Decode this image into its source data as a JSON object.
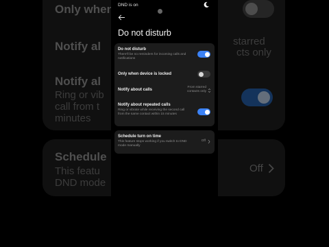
{
  "status": {
    "text": "DND is on"
  },
  "page": {
    "title": "Do not disturb"
  },
  "settings": {
    "dnd": {
      "title": "Do not disturb",
      "subtitle": "There'll be no reminders for incoming calls and notifications",
      "enabled": true
    },
    "locked": {
      "title": "Only when device is locked",
      "enabled": false
    },
    "calls": {
      "title": "Notify about calls",
      "value_line1": "From starred",
      "value_line2": "contacts only"
    },
    "repeated": {
      "title": "Notify about repeated calls",
      "subtitle": "Ring or vibrate while receiving the second call from the same contact within 15 minutes",
      "enabled": true
    }
  },
  "schedule": {
    "title": "Schedule turn on time",
    "subtitle": "This feature stops working if you switch to DND mode manually",
    "value": "Off"
  },
  "background": {
    "only_when": "Only when",
    "notify_al_1": "Notify al",
    "starred": "starred",
    "contacts_only": "cts only",
    "notify_al_2": "Notify al",
    "ring_or_vib": "Ring or vib",
    "call_from_t": "call from t",
    "minutes": "minutes",
    "schedule": "Schedule",
    "this_featu": "This featu",
    "dnd_mode": "DND mode",
    "off": "Off"
  },
  "colors": {
    "accent": "#3b82f6",
    "card": "#1c1c1c",
    "background": "#000000"
  }
}
